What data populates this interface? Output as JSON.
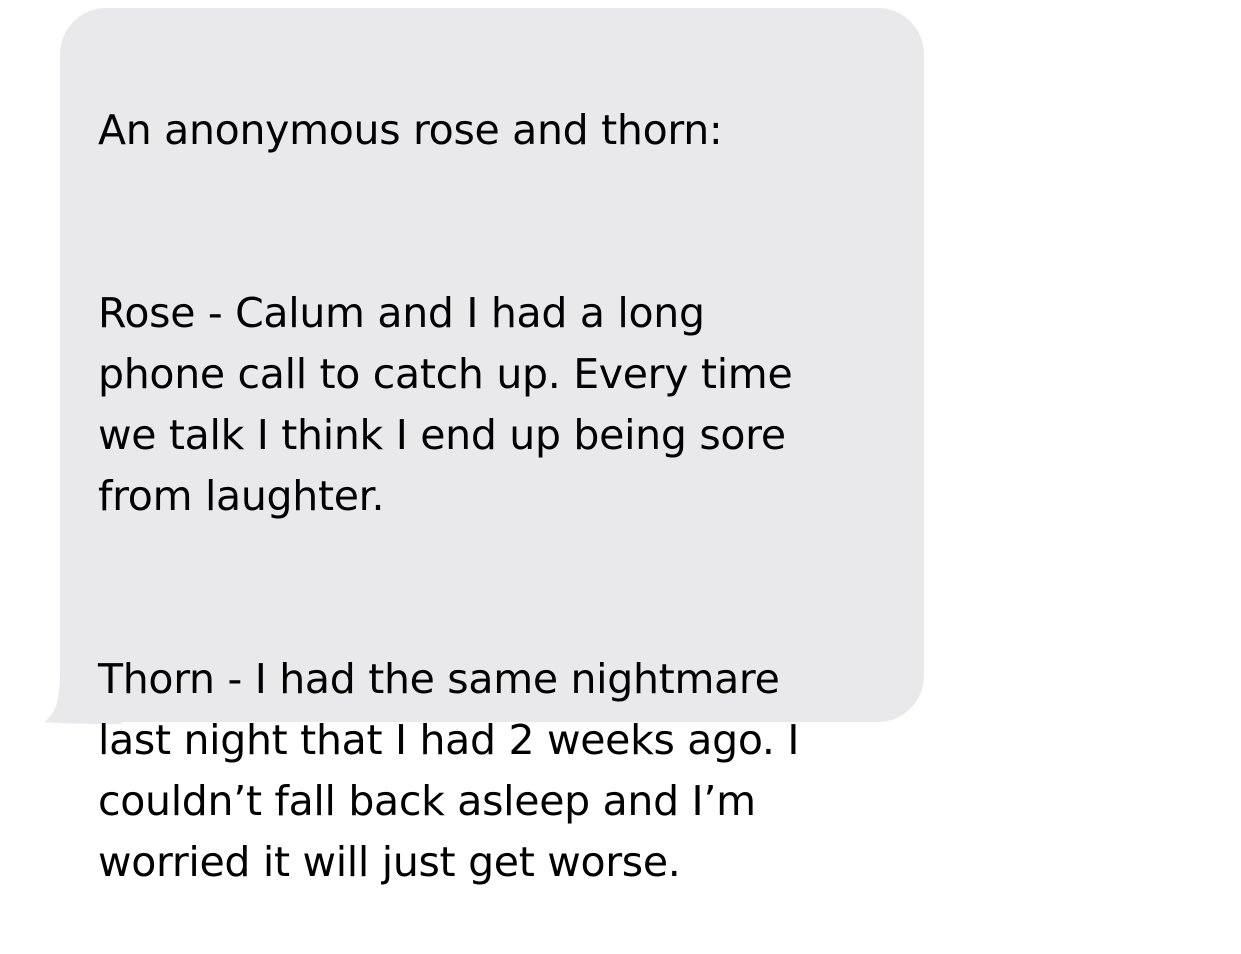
{
  "message": {
    "intro": "An anonymous rose and thorn:",
    "rose": "Rose - Calum and I had a long\nphone call to catch up. Every time\nwe talk I think I end up being sore\nfrom laughter.",
    "thorn": "Thorn - I had the same nightmare\nlast night that I had 2 weeks ago. I\ncouldn’t fall back asleep and I’m\nworried it will just get worse."
  },
  "colors": {
    "bubble": "#e9e9eb",
    "text": "#000000",
    "background": "#ffffff"
  },
  "icons": [
    "bubble-tail-icon"
  ]
}
